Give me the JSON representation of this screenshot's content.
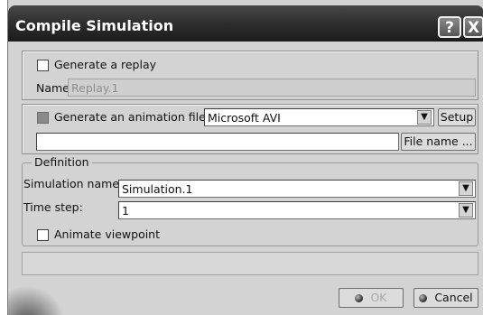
{
  "window": {
    "title": "Compile Simulation",
    "help_glyph": "?",
    "close_glyph": "X"
  },
  "replay": {
    "checkbox_label": "Generate a replay",
    "checked": false,
    "name_label": "Name:",
    "name_value": "Replay.1"
  },
  "animation": {
    "checkbox_label": "Generate an animation file",
    "checked": false,
    "enabled": false,
    "format_value": "Microsoft AVI",
    "setup_label": "Setup",
    "file_path_value": "",
    "file_name_label": "File name ..."
  },
  "definition": {
    "group_label": "Definition",
    "simulation_name_label": "Simulation name:",
    "simulation_name_value": "Simulation.1",
    "time_step_label": "Time step:",
    "time_step_value": "1",
    "animate_viewpoint_label": "Animate viewpoint",
    "animate_viewpoint_checked": false
  },
  "status_text": "",
  "footer": {
    "ok_label": "OK",
    "cancel_label": "Cancel"
  },
  "icons": {
    "dropdown": "▼"
  }
}
